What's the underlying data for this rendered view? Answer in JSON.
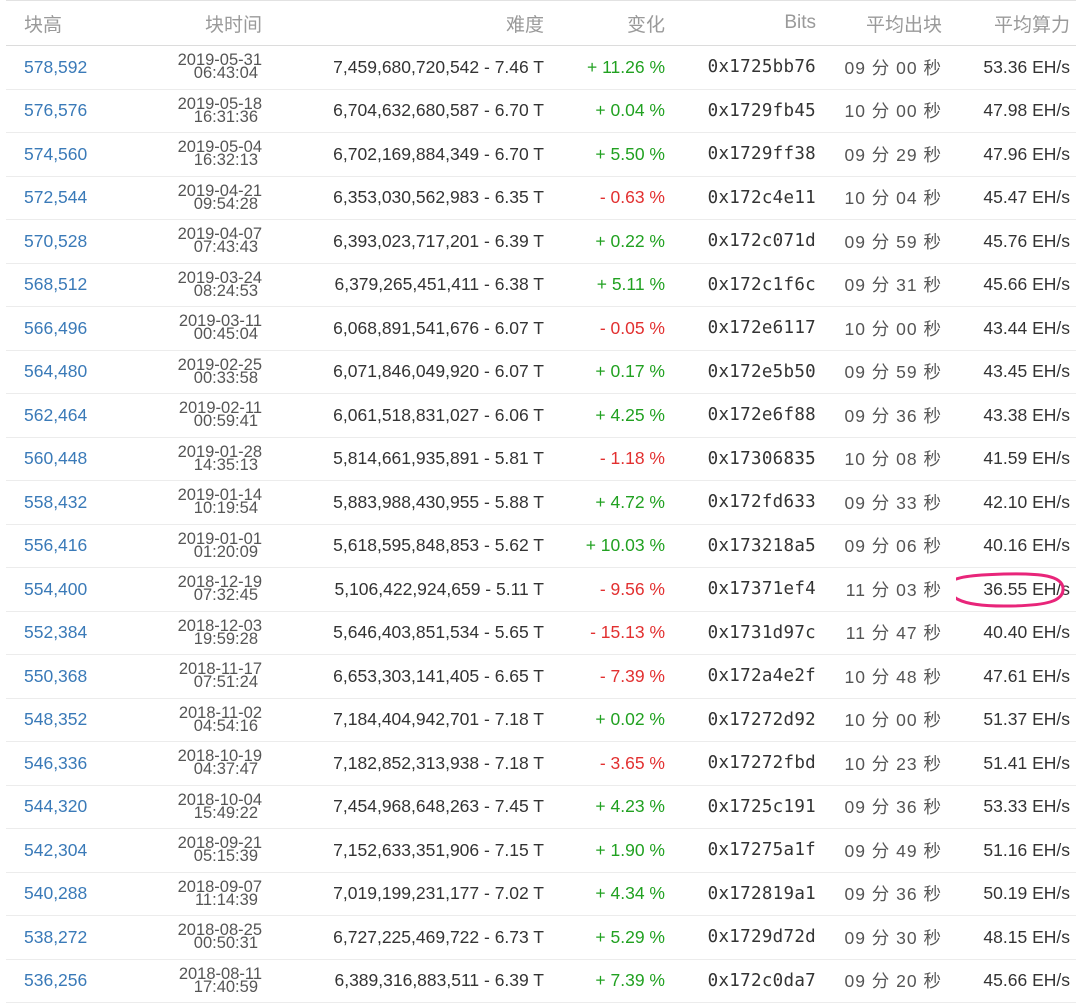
{
  "columns": [
    "块高",
    "块时间",
    "难度",
    "变化",
    "Bits",
    "平均出块",
    "平均算力"
  ],
  "colors": {
    "link": "#3a7ab8",
    "positive": "#21a121",
    "negative": "#e23030",
    "annotation": "#e8257a"
  },
  "rows": [
    {
      "height": "578,592",
      "date": "2019-05-31",
      "time": "06:43:04",
      "difficulty": "7,459,680,720,542 - 7.46 T",
      "change": "+ 11.26 %",
      "bits": "0x1725bb76",
      "avg_block": "09 分 00 秒",
      "hashrate": "53.36 EH/s"
    },
    {
      "height": "576,576",
      "date": "2019-05-18",
      "time": "16:31:36",
      "difficulty": "6,704,632,680,587 - 6.70 T",
      "change": "+ 0.04 %",
      "bits": "0x1729fb45",
      "avg_block": "10 分 00 秒",
      "hashrate": "47.98 EH/s"
    },
    {
      "height": "574,560",
      "date": "2019-05-04",
      "time": "16:32:13",
      "difficulty": "6,702,169,884,349 - 6.70 T",
      "change": "+ 5.50 %",
      "bits": "0x1729ff38",
      "avg_block": "09 分 29 秒",
      "hashrate": "47.96 EH/s"
    },
    {
      "height": "572,544",
      "date": "2019-04-21",
      "time": "09:54:28",
      "difficulty": "6,353,030,562,983 - 6.35 T",
      "change": "- 0.63 %",
      "bits": "0x172c4e11",
      "avg_block": "10 分 04 秒",
      "hashrate": "45.47 EH/s"
    },
    {
      "height": "570,528",
      "date": "2019-04-07",
      "time": "07:43:43",
      "difficulty": "6,393,023,717,201 - 6.39 T",
      "change": "+ 0.22 %",
      "bits": "0x172c071d",
      "avg_block": "09 分 59 秒",
      "hashrate": "45.76 EH/s"
    },
    {
      "height": "568,512",
      "date": "2019-03-24",
      "time": "08:24:53",
      "difficulty": "6,379,265,451,411 - 6.38 T",
      "change": "+ 5.11 %",
      "bits": "0x172c1f6c",
      "avg_block": "09 分 31 秒",
      "hashrate": "45.66 EH/s"
    },
    {
      "height": "566,496",
      "date": "2019-03-11",
      "time": "00:45:04",
      "difficulty": "6,068,891,541,676 - 6.07 T",
      "change": "- 0.05 %",
      "bits": "0x172e6117",
      "avg_block": "10 分 00 秒",
      "hashrate": "43.44 EH/s"
    },
    {
      "height": "564,480",
      "date": "2019-02-25",
      "time": "00:33:58",
      "difficulty": "6,071,846,049,920 - 6.07 T",
      "change": "+ 0.17 %",
      "bits": "0x172e5b50",
      "avg_block": "09 分 59 秒",
      "hashrate": "43.45 EH/s"
    },
    {
      "height": "562,464",
      "date": "2019-02-11",
      "time": "00:59:41",
      "difficulty": "6,061,518,831,027 - 6.06 T",
      "change": "+ 4.25 %",
      "bits": "0x172e6f88",
      "avg_block": "09 分 36 秒",
      "hashrate": "43.38 EH/s"
    },
    {
      "height": "560,448",
      "date": "2019-01-28",
      "time": "14:35:13",
      "difficulty": "5,814,661,935,891 - 5.81 T",
      "change": "- 1.18 %",
      "bits": "0x17306835",
      "avg_block": "10 分 08 秒",
      "hashrate": "41.59 EH/s"
    },
    {
      "height": "558,432",
      "date": "2019-01-14",
      "time": "10:19:54",
      "difficulty": "5,883,988,430,955 - 5.88 T",
      "change": "+ 4.72 %",
      "bits": "0x172fd633",
      "avg_block": "09 分 33 秒",
      "hashrate": "42.10 EH/s"
    },
    {
      "height": "556,416",
      "date": "2019-01-01",
      "time": "01:20:09",
      "difficulty": "5,618,595,848,853 - 5.62 T",
      "change": "+ 10.03 %",
      "bits": "0x173218a5",
      "avg_block": "09 分 06 秒",
      "hashrate": "40.16 EH/s"
    },
    {
      "height": "554,400",
      "date": "2018-12-19",
      "time": "07:32:45",
      "difficulty": "5,106,422,924,659 - 5.11 T",
      "change": "- 9.56 %",
      "bits": "0x17371ef4",
      "avg_block": "11 分 03 秒",
      "hashrate": "36.55 EH/s",
      "circled": true
    },
    {
      "height": "552,384",
      "date": "2018-12-03",
      "time": "19:59:28",
      "difficulty": "5,646,403,851,534 - 5.65 T",
      "change": "- 15.13 %",
      "bits": "0x1731d97c",
      "avg_block": "11 分 47 秒",
      "hashrate": "40.40 EH/s"
    },
    {
      "height": "550,368",
      "date": "2018-11-17",
      "time": "07:51:24",
      "difficulty": "6,653,303,141,405 - 6.65 T",
      "change": "- 7.39 %",
      "bits": "0x172a4e2f",
      "avg_block": "10 分 48 秒",
      "hashrate": "47.61 EH/s"
    },
    {
      "height": "548,352",
      "date": "2018-11-02",
      "time": "04:54:16",
      "difficulty": "7,184,404,942,701 - 7.18 T",
      "change": "+ 0.02 %",
      "bits": "0x17272d92",
      "avg_block": "10 分 00 秒",
      "hashrate": "51.37 EH/s"
    },
    {
      "height": "546,336",
      "date": "2018-10-19",
      "time": "04:37:47",
      "difficulty": "7,182,852,313,938 - 7.18 T",
      "change": "- 3.65 %",
      "bits": "0x17272fbd",
      "avg_block": "10 分 23 秒",
      "hashrate": "51.41 EH/s"
    },
    {
      "height": "544,320",
      "date": "2018-10-04",
      "time": "15:49:22",
      "difficulty": "7,454,968,648,263 - 7.45 T",
      "change": "+ 4.23 %",
      "bits": "0x1725c191",
      "avg_block": "09 分 36 秒",
      "hashrate": "53.33 EH/s"
    },
    {
      "height": "542,304",
      "date": "2018-09-21",
      "time": "05:15:39",
      "difficulty": "7,152,633,351,906 - 7.15 T",
      "change": "+ 1.90 %",
      "bits": "0x17275a1f",
      "avg_block": "09 分 49 秒",
      "hashrate": "51.16 EH/s"
    },
    {
      "height": "540,288",
      "date": "2018-09-07",
      "time": "11:14:39",
      "difficulty": "7,019,199,231,177 - 7.02 T",
      "change": "+ 4.34 %",
      "bits": "0x172819a1",
      "avg_block": "09 分 36 秒",
      "hashrate": "50.19 EH/s"
    },
    {
      "height": "538,272",
      "date": "2018-08-25",
      "time": "00:50:31",
      "difficulty": "6,727,225,469,722 - 6.73 T",
      "change": "+ 5.29 %",
      "bits": "0x1729d72d",
      "avg_block": "09 分 30 秒",
      "hashrate": "48.15 EH/s"
    },
    {
      "height": "536,256",
      "date": "2018-08-11",
      "time": "17:40:59",
      "difficulty": "6,389,316,883,511 - 6.39 T",
      "change": "+ 7.39 %",
      "bits": "0x172c0da7",
      "avg_block": "09 分 20 秒",
      "hashrate": "45.66 EH/s"
    }
  ]
}
